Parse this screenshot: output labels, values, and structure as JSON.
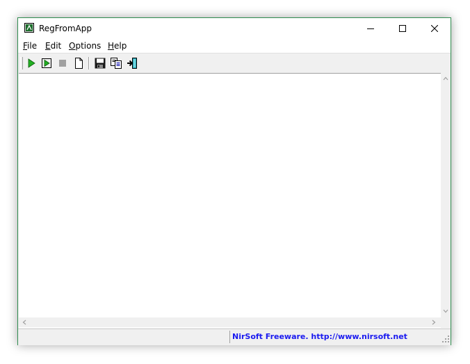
{
  "window": {
    "title": "RegFromApp"
  },
  "menu": [
    {
      "key": "F",
      "rest": "ile"
    },
    {
      "key": "E",
      "rest": "dit"
    },
    {
      "key": "O",
      "rest": "ptions"
    },
    {
      "key": "H",
      "rest": "elp"
    }
  ],
  "toolbar": {
    "icons": [
      "play-icon",
      "play-framed-icon",
      "stop-icon",
      "new-document-icon",
      "save-icon",
      "copy-icon",
      "exit-icon"
    ]
  },
  "status": {
    "left": "",
    "link_text": "NirSoft Freeware.  http://www.nirsoft.net"
  },
  "colors": {
    "accent": "#2f8c4f",
    "link": "#1a1af0",
    "play": "#22b022"
  }
}
